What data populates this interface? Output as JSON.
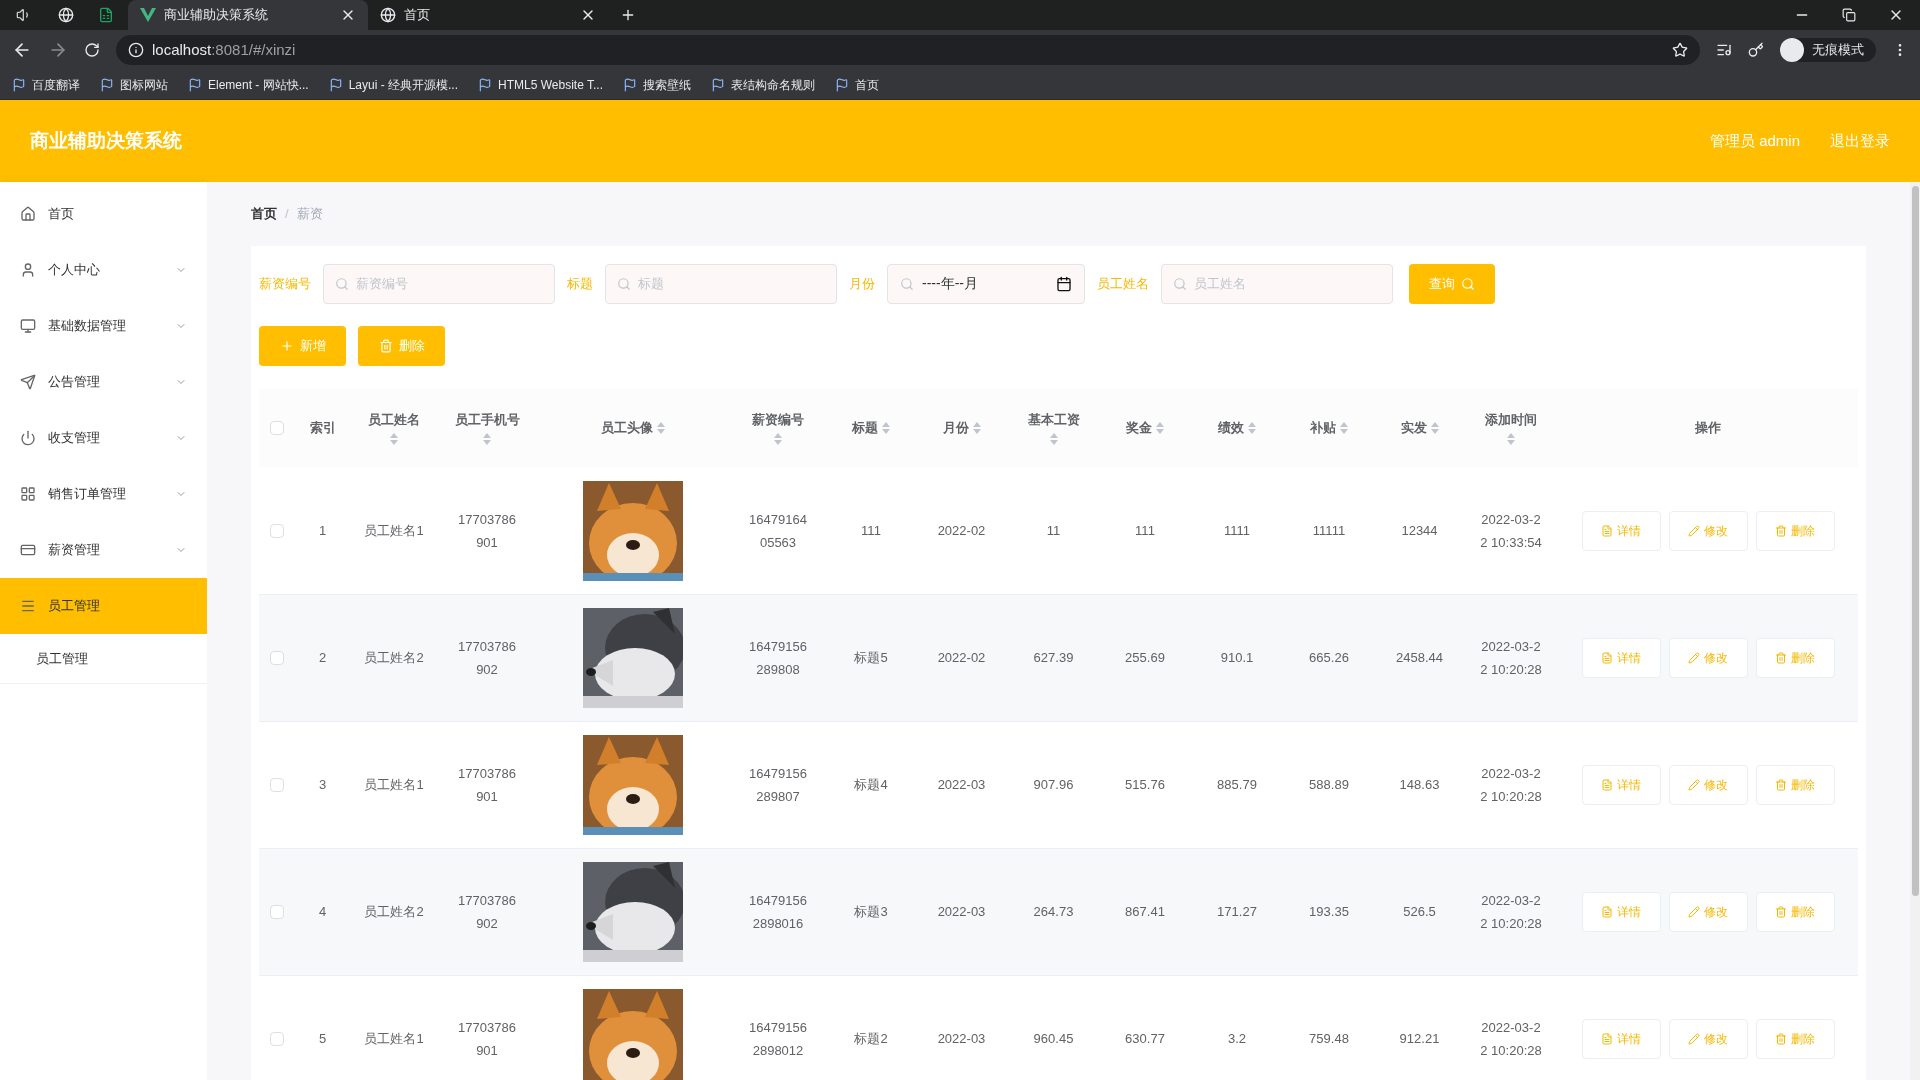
{
  "browser": {
    "tabs": [
      {
        "title": "商业辅助决策系统",
        "selected": true
      },
      {
        "title": "首页",
        "selected": false
      }
    ],
    "address": {
      "host": "localhost",
      "path": ":8081/#/xinzi"
    },
    "profile": "无痕模式",
    "bookmarks": [
      "百度翻译",
      "图标网站",
      "Element - 网站快...",
      "Layui - 经典开源模...",
      "HTML5 Website T...",
      "搜索壁纸",
      "表结构命名规则",
      "首页"
    ]
  },
  "header": {
    "title": "商业辅助决策系统",
    "user": "管理员 admin",
    "logout": "退出登录"
  },
  "sidebar": {
    "items": [
      {
        "label": "首页",
        "selected": false,
        "has_children": false
      },
      {
        "label": "个人中心",
        "expanded": false,
        "selected": false,
        "has_children": true
      },
      {
        "label": "基础数据管理",
        "expanded": false,
        "selected": false,
        "has_children": true
      },
      {
        "label": "公告管理",
        "expanded": false,
        "selected": false,
        "has_children": true
      },
      {
        "label": "收支管理",
        "expanded": false,
        "selected": false,
        "has_children": true
      },
      {
        "label": "销售订单管理",
        "expanded": false,
        "selected": false,
        "has_children": true
      },
      {
        "label": "薪资管理",
        "expanded": false,
        "selected": false,
        "has_children": true
      },
      {
        "label": "员工管理",
        "expanded": true,
        "selected": true,
        "has_children": true,
        "children": [
          {
            "label": "员工管理"
          }
        ]
      }
    ]
  },
  "breadcrumb": {
    "items": [
      "首页",
      "薪资"
    ],
    "separator": "/"
  },
  "filters": [
    {
      "label": "薪资编号",
      "placeholder": "薪资编号",
      "kind": "text"
    },
    {
      "label": "标题",
      "placeholder": "标题",
      "kind": "text"
    },
    {
      "label": "月份",
      "value": "----年--月",
      "kind": "month"
    },
    {
      "label": "员工姓名",
      "placeholder": "员工姓名",
      "kind": "text"
    }
  ],
  "search_button": "查询",
  "buttons": [
    {
      "label": "新增",
      "kind": "add"
    },
    {
      "label": "删除",
      "kind": "delete"
    }
  ],
  "table": {
    "select_all": {
      "checked": false
    },
    "columns": [
      {
        "label": "索引",
        "sortable": false
      },
      {
        "label": "员工姓名",
        "sortable": true,
        "wrap": true
      },
      {
        "label": "员工手机号",
        "sortable": true,
        "wrap": true
      },
      {
        "label": "员工头像",
        "sortable": true,
        "wrap": false
      },
      {
        "label": "薪资编号",
        "sortable": true,
        "wrap": true
      },
      {
        "label": "标题",
        "sortable": true,
        "wrap": false
      },
      {
        "label": "月份",
        "sortable": true,
        "wrap": false
      },
      {
        "label": "基本工资",
        "sortable": true,
        "wrap": true
      },
      {
        "label": "奖金",
        "sortable": true,
        "wrap": false
      },
      {
        "label": "绩效",
        "sortable": true,
        "wrap": false
      },
      {
        "label": "补贴",
        "sortable": true,
        "wrap": false
      },
      {
        "label": "实发",
        "sortable": true,
        "wrap": false
      },
      {
        "label": "添加时间",
        "sortable": true,
        "wrap": true
      },
      {
        "label": "操作",
        "sortable": false
      }
    ],
    "rows": [
      {
        "checked": false,
        "index": "1",
        "name": "员工姓名1",
        "phone": [
          "17703786",
          "901"
        ],
        "avatar": {
          "kind": "picture"
        },
        "code": [
          "16479164",
          "05563"
        ],
        "title": "111",
        "month": "2022-02",
        "base": "11",
        "bonus": "111",
        "perf": "1111",
        "allowance": "11111",
        "net": "12344",
        "time": [
          "2022-03-2",
          "2 10:33:54"
        ],
        "actions": [
          "详情",
          "修改",
          "删除"
        ]
      },
      {
        "checked": false,
        "index": "2",
        "name": "员工姓名2",
        "phone": [
          "17703786",
          "902"
        ],
        "avatar": {
          "kind": "picture"
        },
        "code": [
          "16479156",
          "289808"
        ],
        "title": "标题5",
        "month": "2022-02",
        "base": "627.39",
        "bonus": "255.69",
        "perf": "910.1",
        "allowance": "665.26",
        "net": "2458.44",
        "time": [
          "2022-03-2",
          "2 10:20:28"
        ],
        "actions": [
          "详情",
          "修改",
          "删除"
        ]
      },
      {
        "checked": false,
        "index": "3",
        "name": "员工姓名1",
        "phone": [
          "17703786",
          "901"
        ],
        "avatar": {
          "kind": "picture"
        },
        "code": [
          "16479156",
          "289807"
        ],
        "title": "标题4",
        "month": "2022-03",
        "base": "907.96",
        "bonus": "515.76",
        "perf": "885.79",
        "allowance": "588.89",
        "net": "148.63",
        "time": [
          "2022-03-2",
          "2 10:20:28"
        ],
        "actions": [
          "详情",
          "修改",
          "删除"
        ]
      },
      {
        "checked": false,
        "index": "4",
        "name": "员工姓名2",
        "phone": [
          "17703786",
          "902"
        ],
        "avatar": {
          "kind": "picture"
        },
        "code": [
          "16479156",
          "2898016"
        ],
        "title": "标题3",
        "month": "2022-03",
        "base": "264.73",
        "bonus": "867.41",
        "perf": "171.27",
        "allowance": "193.35",
        "net": "526.5",
        "time": [
          "2022-03-2",
          "2 10:20:28"
        ],
        "actions": [
          "详情",
          "修改",
          "删除"
        ]
      },
      {
        "checked": false,
        "index": "5",
        "name": "员工姓名1",
        "phone": [
          "17703786",
          "901"
        ],
        "avatar": {
          "kind": "picture"
        },
        "code": [
          "16479156",
          "2898012"
        ],
        "title": "标题2",
        "month": "2022-03",
        "base": "960.45",
        "bonus": "630.77",
        "perf": "3.2",
        "allowance": "759.48",
        "net": "912.21",
        "time": [
          "2022-03-2",
          "2 10:20:28"
        ],
        "actions": [
          "详情",
          "修改",
          "删除"
        ]
      }
    ]
  }
}
